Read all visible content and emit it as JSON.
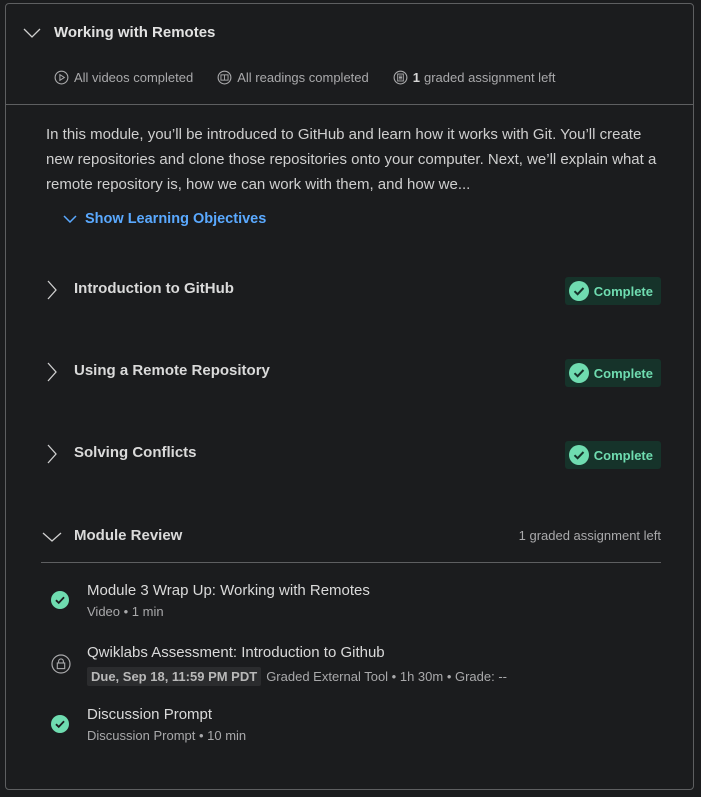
{
  "module": {
    "title": "Working with Remotes",
    "stats": {
      "videos": "All videos completed",
      "readings": "All readings completed",
      "assignments_count": "1",
      "assignments_text": "graded assignment left"
    },
    "description": "In this module, you’ll be introduced to GitHub and learn how it works with Git. You’ll create new repositories and clone those repositories onto your computer. Next, we’ll explain what a remote repository is, how we can work with them, and how we...",
    "objectives_label": "Show Learning Objectives"
  },
  "lessons": [
    {
      "title": "Introduction to GitHub",
      "status": "Complete"
    },
    {
      "title": "Using a Remote Repository",
      "status": "Complete"
    },
    {
      "title": "Solving Conflicts",
      "status": "Complete"
    }
  ],
  "review": {
    "title": "Module Review",
    "meta": "1 graded assignment left",
    "items": [
      {
        "title": "Module 3 Wrap Up: Working with Remotes",
        "meta": "Video • 1 min",
        "state": "completed"
      },
      {
        "title": "Qwiklabs Assessment: Introduction to Github",
        "due": "Due, Sep 18, 11:59 PM PDT",
        "meta": "Graded External Tool • 1h 30m • Grade: --",
        "state": "locked"
      },
      {
        "title": "Discussion Prompt",
        "meta": "Discussion Prompt • 10 min",
        "state": "completed"
      }
    ]
  },
  "colors": {
    "accent_link": "#5aa9ff",
    "complete_green": "#6fdcb0",
    "complete_bg": "#16332a",
    "background": "#1b1c1e"
  }
}
